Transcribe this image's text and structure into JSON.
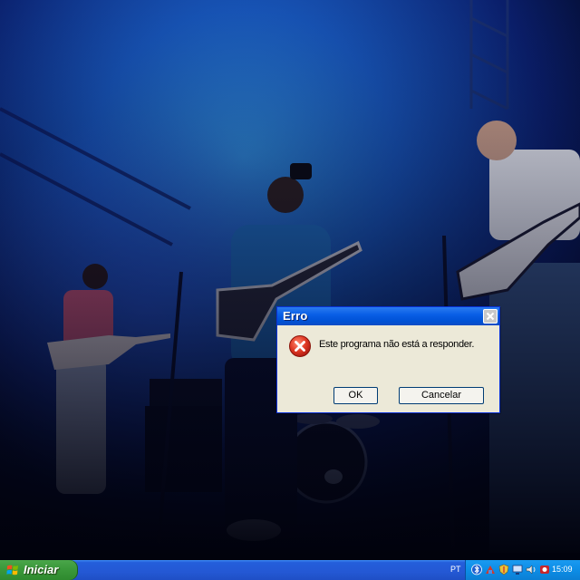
{
  "dialog": {
    "title": "Erro",
    "message": "Este programa não está a responder.",
    "ok_label": "OK",
    "cancel_label": "Cancelar",
    "icon": "error-icon"
  },
  "taskbar": {
    "start_label": "Iniciar",
    "language": "PT",
    "clock": "15:09",
    "tray_icons": [
      "bluetooth-icon",
      "network-icon",
      "security-shield-icon",
      "display-icon",
      "volume-icon",
      "antivirus-icon"
    ]
  },
  "colors": {
    "titlebar": "#0a5fe6",
    "dialog_bg": "#ECE9D8",
    "taskbar": "#245edb",
    "start_button": "#3c9a3c",
    "tray": "#0d8de6",
    "error_red": "#d9301f"
  }
}
